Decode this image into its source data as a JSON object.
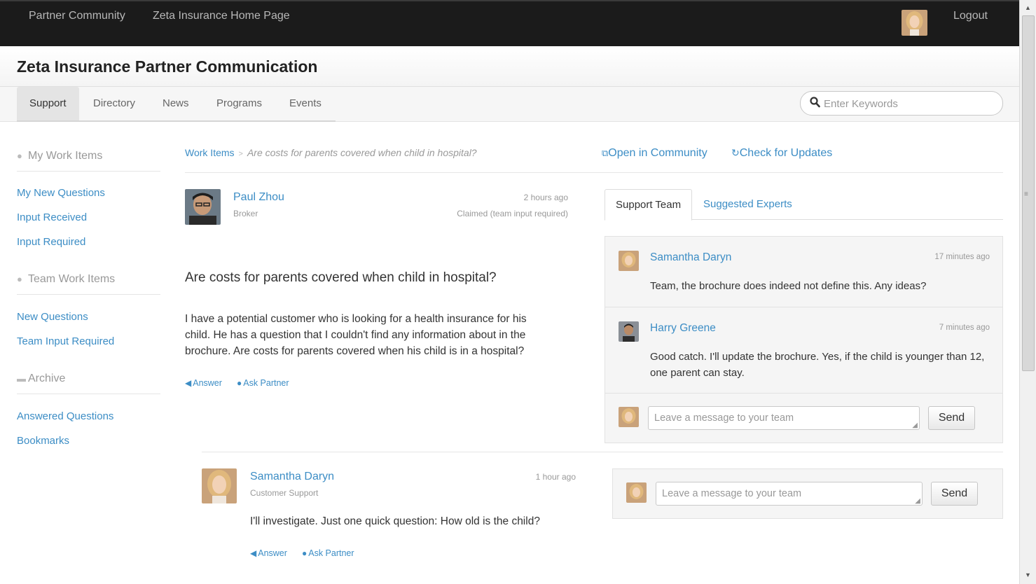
{
  "topbar": {
    "links": [
      "Partner Community",
      "Zeta Insurance Home Page"
    ],
    "logout": "Logout"
  },
  "header": {
    "title": "Zeta Insurance Partner Communication"
  },
  "tabs": [
    "Support",
    "Directory",
    "News",
    "Programs",
    "Events"
  ],
  "active_tab": "Support",
  "search": {
    "placeholder": "Enter Keywords"
  },
  "sidebar": {
    "my_work_items": {
      "heading": "My Work Items",
      "links": [
        "My New Questions",
        "Input Received",
        "Input Required"
      ]
    },
    "team_work_items": {
      "heading": "Team Work Items",
      "links": [
        "New Questions",
        "Team Input Required"
      ]
    },
    "archive": {
      "heading": "Archive",
      "links": [
        "Answered Questions",
        "Bookmarks"
      ]
    }
  },
  "breadcrumb": {
    "root": "Work Items",
    "separator": ">",
    "current": "Are costs for parents covered when child in hospital?"
  },
  "actions": {
    "open_in_community": "Open in Community",
    "check_for_updates": "Check for Updates"
  },
  "question_post": {
    "author": "Paul Zhou",
    "role": "Broker",
    "time": "2 hours ago",
    "status": "Claimed (team input required)",
    "title": "Are costs for parents covered when child in hospital?",
    "body_lines": [
      "I have a potential customer who is looking for a health insurance for his",
      "child. He has a question that I couldn't find any information about in the",
      "brochure. Are costs for parents covered when his child is in a hospital?"
    ],
    "answer": "Answer",
    "ask_partner": "Ask Partner"
  },
  "reply_post": {
    "author": "Samantha Daryn",
    "role": "Customer Support",
    "time": "1 hour ago",
    "body": "I'll investigate. Just one quick question: How old is the child?",
    "answer": "Answer",
    "ask_partner": "Ask Partner"
  },
  "right_tabs": [
    "Support Team",
    "Suggested Experts"
  ],
  "team_chat": {
    "messages": [
      {
        "author": "Samantha Daryn",
        "time": "17 minutes ago",
        "text_lines": [
          "Team, the brochure does indeed not define this. Any ideas?"
        ]
      },
      {
        "author": "Harry Greene",
        "time": "7 minutes ago",
        "text_lines": [
          "Good catch. I'll update the brochure. Yes, if the child is younger than 12,",
          "one parent can stay."
        ]
      }
    ],
    "input_placeholder": "Leave a message to your team",
    "send": "Send"
  },
  "reply_chat": {
    "input_placeholder": "Leave a message to your team",
    "send": "Send"
  },
  "colors": {
    "link": "#3c8dc5",
    "topbar": "#1b1b1b",
    "muted": "#999999"
  },
  "icons": [
    "search-icon",
    "speech-bubble-icon",
    "team-bubbles-icon",
    "archive-box-icon",
    "open-external-icon",
    "refresh-icon",
    "reply-arrow-icon",
    "ask-partner-icon"
  ]
}
